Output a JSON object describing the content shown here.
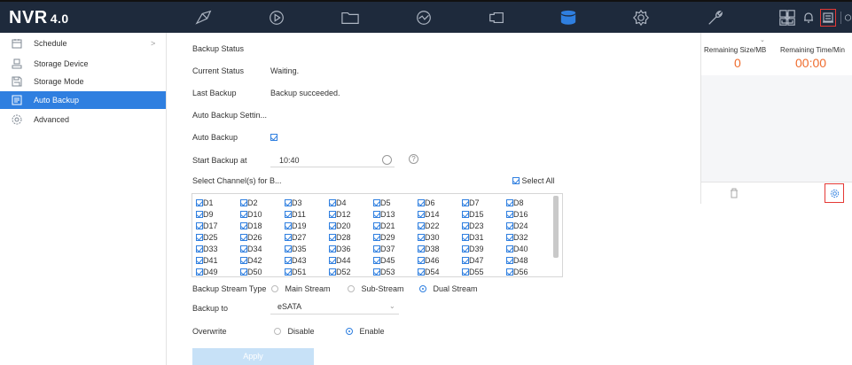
{
  "topbar": {
    "logo": "NVR",
    "version": "4.0",
    "nav": [
      "live-view-icon",
      "playback-icon",
      "file-folder-icon",
      "smart-analysis-icon",
      "camera-icon",
      "storage-icon",
      "settings-icon",
      "maintenance-icon",
      "multi-view-icon"
    ],
    "active_nav": "storage-icon"
  },
  "sidebar": {
    "items": [
      {
        "label": "Schedule",
        "icon": "calendar-icon",
        "arrow": ">"
      },
      {
        "label": "Storage Device",
        "icon": "storage-device-icon"
      },
      {
        "label": "Storage Mode",
        "icon": "save-icon"
      },
      {
        "label": "Auto Backup",
        "icon": "backup-icon",
        "active": true
      },
      {
        "label": "Advanced",
        "icon": "gear-icon"
      }
    ]
  },
  "main": {
    "backup_status_title": "Backup Status",
    "current_status_label": "Current Status",
    "current_status_value": "Waiting.",
    "last_backup_label": "Last Backup",
    "last_backup_value": "Backup succeeded.",
    "settings_title": "Auto Backup Settin...",
    "auto_backup_label": "Auto Backup",
    "start_backup_label": "Start Backup at",
    "start_backup_value": "10:40",
    "help_glyph": "?",
    "select_channels_label": "Select Channel(s) for B...",
    "select_all_label": "Select All",
    "channels": [
      "D1",
      "D2",
      "D3",
      "D4",
      "D5",
      "D6",
      "D7",
      "D8",
      "D9",
      "D10",
      "D11",
      "D12",
      "D13",
      "D14",
      "D15",
      "D16",
      "D17",
      "D18",
      "D19",
      "D20",
      "D21",
      "D22",
      "D23",
      "D24",
      "D25",
      "D26",
      "D27",
      "D28",
      "D29",
      "D30",
      "D31",
      "D32",
      "D33",
      "D34",
      "D35",
      "D36",
      "D37",
      "D38",
      "D39",
      "D40",
      "D41",
      "D42",
      "D43",
      "D44",
      "D45",
      "D46",
      "D47",
      "D48",
      "D49",
      "D50",
      "D51",
      "D52",
      "D53",
      "D54",
      "D55",
      "D56"
    ],
    "stream_type_label": "Backup Stream Type",
    "stream_options": [
      "Main Stream",
      "Sub-Stream",
      "Dual Stream"
    ],
    "stream_selected": "Dual Stream",
    "backup_to_label": "Backup to",
    "backup_to_value": "eSATA",
    "overwrite_label": "Overwrite",
    "overwrite_options": [
      "Disable",
      "Enable"
    ],
    "overwrite_selected": "Enable",
    "apply_label": "Apply"
  },
  "right_panel": {
    "remaining_size_label": "Remaining Size/MB",
    "remaining_size_value": "0",
    "remaining_time_label": "Remaining Time/Min",
    "remaining_time_value": "00:00"
  }
}
